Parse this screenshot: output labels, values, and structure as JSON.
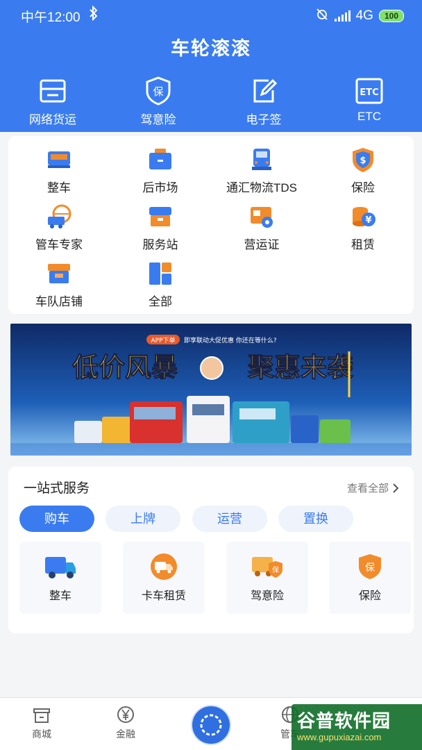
{
  "status_bar": {
    "time": "中午12:00",
    "network": "4G",
    "battery": "100"
  },
  "app_title": "车轮滚滚",
  "quick_actions": [
    {
      "label": "网络货运",
      "icon": "cargo-icon"
    },
    {
      "label": "驾意险",
      "icon": "insurance-shield-icon"
    },
    {
      "label": "电子签",
      "icon": "esign-icon"
    },
    {
      "label": "ETC",
      "icon": "etc-icon"
    }
  ],
  "grid": [
    {
      "label": "整车",
      "icon": "truck-icon"
    },
    {
      "label": "后市场",
      "icon": "toolbox-icon"
    },
    {
      "label": "通汇物流TDS",
      "icon": "semi-truck-icon"
    },
    {
      "label": "保险",
      "icon": "dollar-shield-icon"
    },
    {
      "label": "管车专家",
      "icon": "globe-truck-icon"
    },
    {
      "label": "服务站",
      "icon": "service-box-icon"
    },
    {
      "label": "营运证",
      "icon": "license-card-icon"
    },
    {
      "label": "租赁",
      "icon": "coin-stack-icon"
    },
    {
      "label": "车队店铺",
      "icon": "shop-icon"
    },
    {
      "label": "全部",
      "icon": "all-blocks-icon"
    }
  ],
  "banner": {
    "tag": "APP下单",
    "subtitle": "即享联动大促优惠 你还在等什么?",
    "headline_left": "低价风暴",
    "headline_right": "聚惠来袭"
  },
  "services": {
    "title": "一站式服务",
    "more": "查看全部",
    "tabs": [
      "购车",
      "上牌",
      "运营",
      "置换"
    ],
    "active_tab": 0,
    "items": [
      {
        "label": "整车",
        "icon": "truck-icon"
      },
      {
        "label": "卡车租赁",
        "icon": "truck-rental-icon"
      },
      {
        "label": "驾意险",
        "icon": "insured-truck-icon"
      },
      {
        "label": "保险",
        "icon": "insurance-shield-icon"
      }
    ]
  },
  "tabbar": [
    {
      "label": "商城",
      "icon": "store-icon"
    },
    {
      "label": "金融",
      "icon": "yen-circle-icon"
    },
    {
      "label": "",
      "icon": "center-logo-icon"
    },
    {
      "label": "管车",
      "icon": "globe-icon"
    }
  ],
  "watermark": {
    "name": "谷普软件园",
    "url": "www.gupuxiazai.com"
  },
  "colors": {
    "primary": "#3a7cf0",
    "orange": "#f28b2a",
    "background": "#f4f5f7"
  }
}
